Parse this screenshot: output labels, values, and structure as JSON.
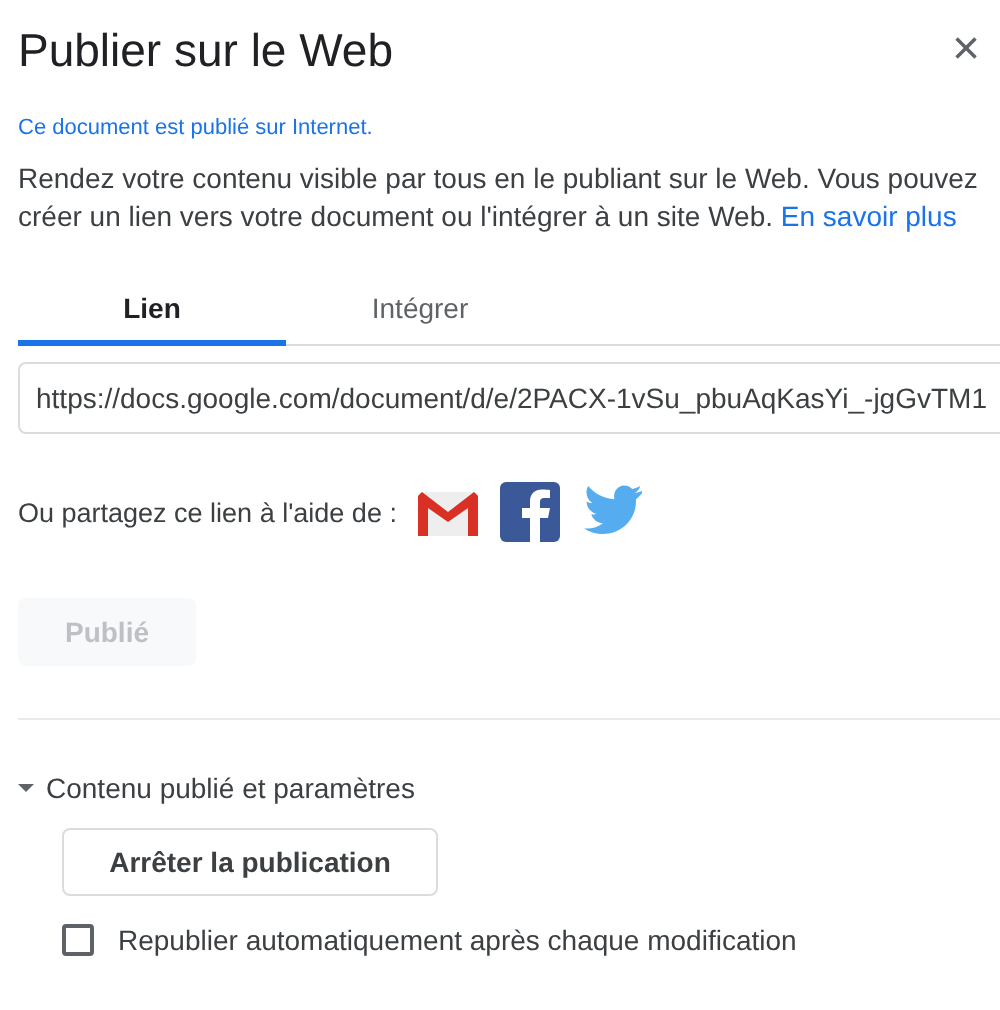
{
  "dialog": {
    "title": "Publier sur le Web",
    "close": "×"
  },
  "notice": "Ce document est publié sur Internet.",
  "description": {
    "text": "Rendez votre contenu visible par tous en le publiant sur le Web. Vous pouvez créer un lien vers votre document ou l'intégrer à un site Web.",
    "link": "En savoir plus"
  },
  "tabs": [
    {
      "label": "Lien",
      "selected": true
    },
    {
      "label": "Intégrer",
      "selected": false
    }
  ],
  "link_field": {
    "value": "https://docs.google.com/document/d/e/2PACX-1vSu_pbuAqKasYi_-jgGvTM1"
  },
  "share": {
    "label": "Ou partagez ce lien à l'aide de :"
  },
  "publish_button": {
    "label": "Publié",
    "disabled": true
  },
  "section": {
    "title": "Contenu publié et paramètres",
    "expanded": true,
    "stop_button": "Arrêter la publication",
    "auto_republish": {
      "label": "Republier automatiquement après chaque modification",
      "checked": false
    }
  }
}
